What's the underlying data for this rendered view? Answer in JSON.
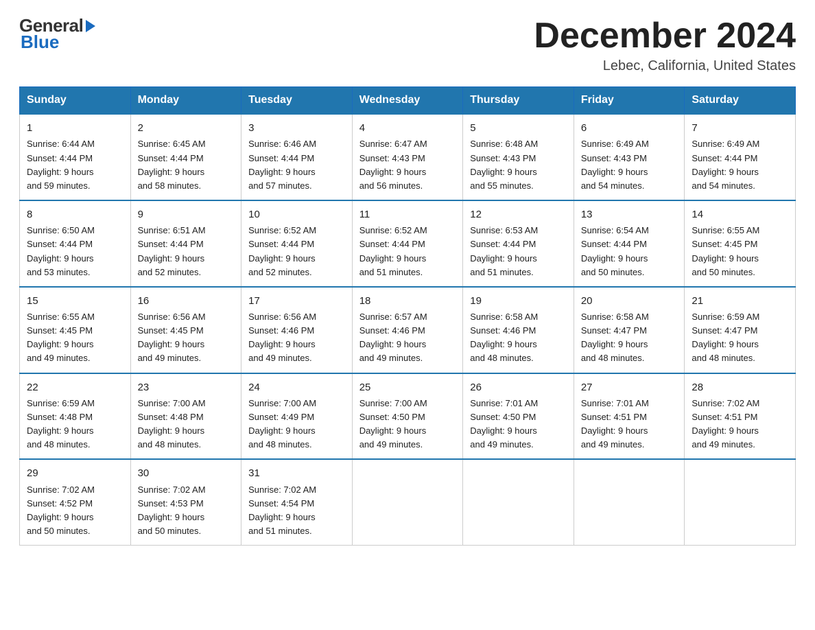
{
  "header": {
    "logo_general": "General",
    "logo_blue": "Blue",
    "title": "December 2024",
    "subtitle": "Lebec, California, United States"
  },
  "days_of_week": [
    "Sunday",
    "Monday",
    "Tuesday",
    "Wednesday",
    "Thursday",
    "Friday",
    "Saturday"
  ],
  "weeks": [
    [
      {
        "day": "1",
        "sunrise": "6:44 AM",
        "sunset": "4:44 PM",
        "daylight": "9 hours and 59 minutes."
      },
      {
        "day": "2",
        "sunrise": "6:45 AM",
        "sunset": "4:44 PM",
        "daylight": "9 hours and 58 minutes."
      },
      {
        "day": "3",
        "sunrise": "6:46 AM",
        "sunset": "4:44 PM",
        "daylight": "9 hours and 57 minutes."
      },
      {
        "day": "4",
        "sunrise": "6:47 AM",
        "sunset": "4:43 PM",
        "daylight": "9 hours and 56 minutes."
      },
      {
        "day": "5",
        "sunrise": "6:48 AM",
        "sunset": "4:43 PM",
        "daylight": "9 hours and 55 minutes."
      },
      {
        "day": "6",
        "sunrise": "6:49 AM",
        "sunset": "4:43 PM",
        "daylight": "9 hours and 54 minutes."
      },
      {
        "day": "7",
        "sunrise": "6:49 AM",
        "sunset": "4:44 PM",
        "daylight": "9 hours and 54 minutes."
      }
    ],
    [
      {
        "day": "8",
        "sunrise": "6:50 AM",
        "sunset": "4:44 PM",
        "daylight": "9 hours and 53 minutes."
      },
      {
        "day": "9",
        "sunrise": "6:51 AM",
        "sunset": "4:44 PM",
        "daylight": "9 hours and 52 minutes."
      },
      {
        "day": "10",
        "sunrise": "6:52 AM",
        "sunset": "4:44 PM",
        "daylight": "9 hours and 52 minutes."
      },
      {
        "day": "11",
        "sunrise": "6:52 AM",
        "sunset": "4:44 PM",
        "daylight": "9 hours and 51 minutes."
      },
      {
        "day": "12",
        "sunrise": "6:53 AM",
        "sunset": "4:44 PM",
        "daylight": "9 hours and 51 minutes."
      },
      {
        "day": "13",
        "sunrise": "6:54 AM",
        "sunset": "4:44 PM",
        "daylight": "9 hours and 50 minutes."
      },
      {
        "day": "14",
        "sunrise": "6:55 AM",
        "sunset": "4:45 PM",
        "daylight": "9 hours and 50 minutes."
      }
    ],
    [
      {
        "day": "15",
        "sunrise": "6:55 AM",
        "sunset": "4:45 PM",
        "daylight": "9 hours and 49 minutes."
      },
      {
        "day": "16",
        "sunrise": "6:56 AM",
        "sunset": "4:45 PM",
        "daylight": "9 hours and 49 minutes."
      },
      {
        "day": "17",
        "sunrise": "6:56 AM",
        "sunset": "4:46 PM",
        "daylight": "9 hours and 49 minutes."
      },
      {
        "day": "18",
        "sunrise": "6:57 AM",
        "sunset": "4:46 PM",
        "daylight": "9 hours and 49 minutes."
      },
      {
        "day": "19",
        "sunrise": "6:58 AM",
        "sunset": "4:46 PM",
        "daylight": "9 hours and 48 minutes."
      },
      {
        "day": "20",
        "sunrise": "6:58 AM",
        "sunset": "4:47 PM",
        "daylight": "9 hours and 48 minutes."
      },
      {
        "day": "21",
        "sunrise": "6:59 AM",
        "sunset": "4:47 PM",
        "daylight": "9 hours and 48 minutes."
      }
    ],
    [
      {
        "day": "22",
        "sunrise": "6:59 AM",
        "sunset": "4:48 PM",
        "daylight": "9 hours and 48 minutes."
      },
      {
        "day": "23",
        "sunrise": "7:00 AM",
        "sunset": "4:48 PM",
        "daylight": "9 hours and 48 minutes."
      },
      {
        "day": "24",
        "sunrise": "7:00 AM",
        "sunset": "4:49 PM",
        "daylight": "9 hours and 48 minutes."
      },
      {
        "day": "25",
        "sunrise": "7:00 AM",
        "sunset": "4:50 PM",
        "daylight": "9 hours and 49 minutes."
      },
      {
        "day": "26",
        "sunrise": "7:01 AM",
        "sunset": "4:50 PM",
        "daylight": "9 hours and 49 minutes."
      },
      {
        "day": "27",
        "sunrise": "7:01 AM",
        "sunset": "4:51 PM",
        "daylight": "9 hours and 49 minutes."
      },
      {
        "day": "28",
        "sunrise": "7:02 AM",
        "sunset": "4:51 PM",
        "daylight": "9 hours and 49 minutes."
      }
    ],
    [
      {
        "day": "29",
        "sunrise": "7:02 AM",
        "sunset": "4:52 PM",
        "daylight": "9 hours and 50 minutes."
      },
      {
        "day": "30",
        "sunrise": "7:02 AM",
        "sunset": "4:53 PM",
        "daylight": "9 hours and 50 minutes."
      },
      {
        "day": "31",
        "sunrise": "7:02 AM",
        "sunset": "4:54 PM",
        "daylight": "9 hours and 51 minutes."
      },
      {
        "day": "",
        "sunrise": "",
        "sunset": "",
        "daylight": ""
      },
      {
        "day": "",
        "sunrise": "",
        "sunset": "",
        "daylight": ""
      },
      {
        "day": "",
        "sunrise": "",
        "sunset": "",
        "daylight": ""
      },
      {
        "day": "",
        "sunrise": "",
        "sunset": "",
        "daylight": ""
      }
    ]
  ],
  "labels": {
    "sunrise_prefix": "Sunrise: ",
    "sunset_prefix": "Sunset: ",
    "daylight_prefix": "Daylight: "
  }
}
